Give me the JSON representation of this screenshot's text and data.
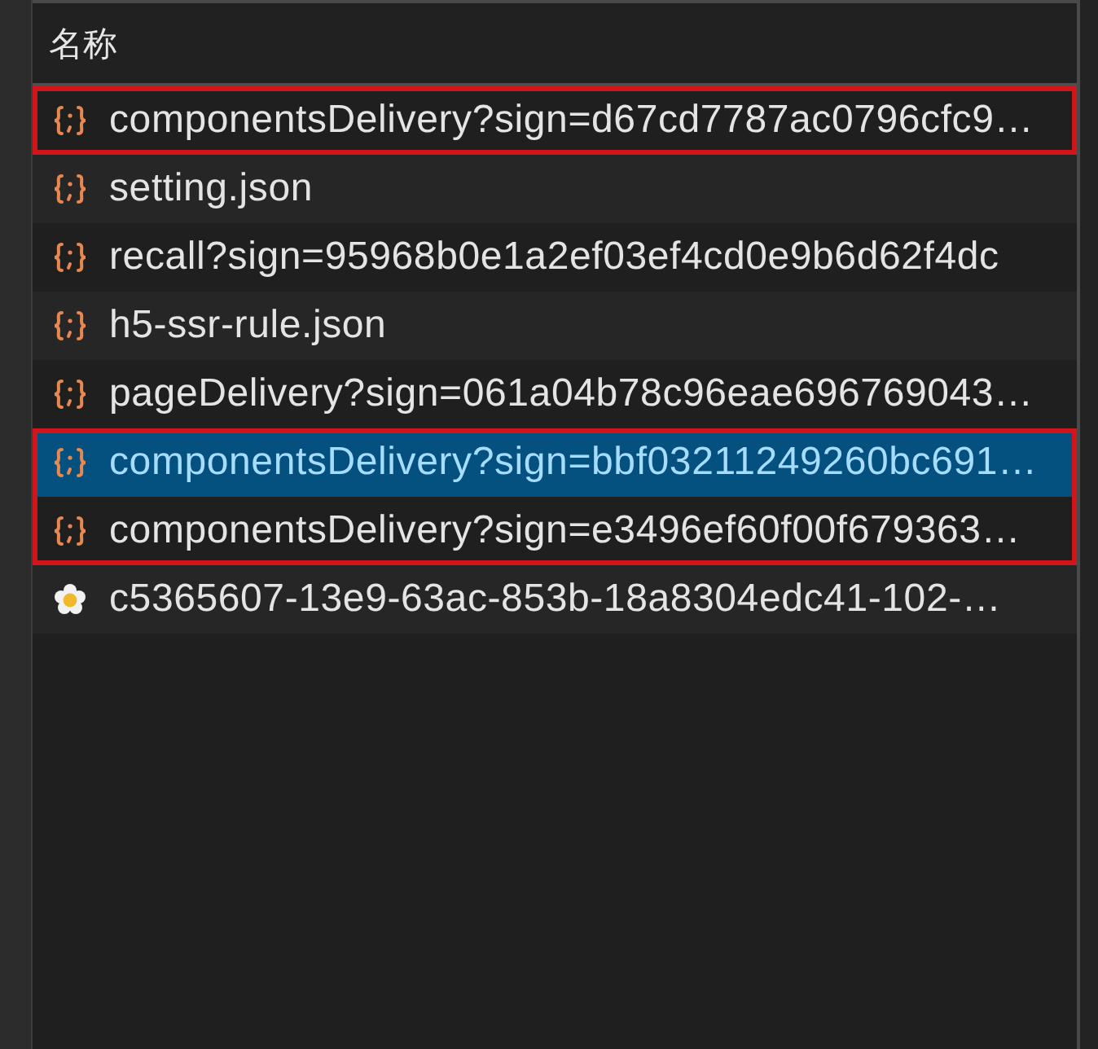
{
  "column_header": "名称",
  "rows": [
    {
      "kind": "json",
      "name": "componentsDelivery?sign=d67cd7787ac0796cfc9…",
      "selected": false,
      "boxed": true
    },
    {
      "kind": "json",
      "name": "setting.json",
      "selected": false,
      "boxed": false
    },
    {
      "kind": "json",
      "name": "recall?sign=95968b0e1a2ef03ef4cd0e9b6d62f4dc",
      "selected": false,
      "boxed": false
    },
    {
      "kind": "json",
      "name": "h5-ssr-rule.json",
      "selected": false,
      "boxed": false
    },
    {
      "kind": "json",
      "name": "pageDelivery?sign=061a04b78c96eae696769043…",
      "selected": false,
      "boxed": false
    },
    {
      "kind": "json",
      "name": "componentsDelivery?sign=bbf03211249260bc691…",
      "selected": true,
      "boxed": true
    },
    {
      "kind": "json",
      "name": "componentsDelivery?sign=e3496ef60f00f679363…",
      "selected": false,
      "boxed": true
    },
    {
      "kind": "image",
      "name": "c5365607-13e9-63ac-853b-18a8304edc41-102-…",
      "selected": false,
      "boxed": false
    }
  ]
}
